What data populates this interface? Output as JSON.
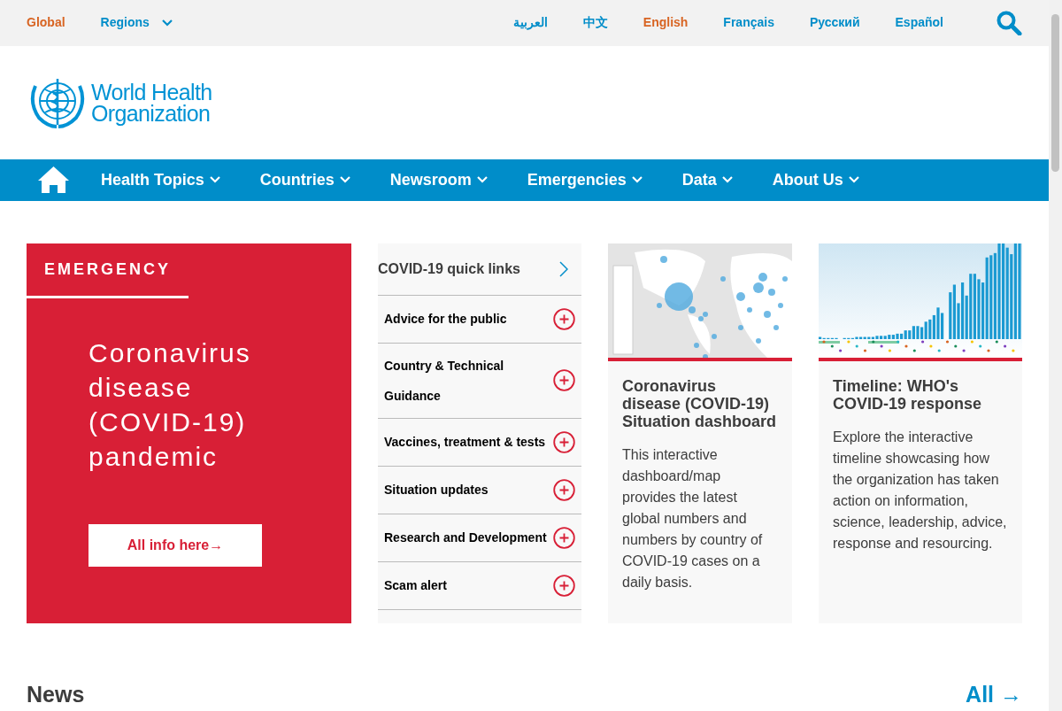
{
  "top_bar": {
    "scopes": [
      {
        "label": "Global",
        "selected": true
      },
      {
        "label": "Regions",
        "selected": false,
        "dropdown": true
      }
    ],
    "languages": [
      {
        "label": "العربية",
        "selected": false
      },
      {
        "label": "中文",
        "selected": false
      },
      {
        "label": "English",
        "selected": true
      },
      {
        "label": "Français",
        "selected": false
      },
      {
        "label": "Русский",
        "selected": false
      },
      {
        "label": "Español",
        "selected": false
      }
    ]
  },
  "logo": {
    "line_1": "World Health",
    "line_2": "Organization"
  },
  "nav": {
    "items": [
      "Health Topics",
      "Countries",
      "Newsroom",
      "Emergencies",
      "Data",
      "About Us"
    ]
  },
  "emergency": {
    "label": "EMERGENCY",
    "title": "Coronavirus disease (COVID-19) pandemic",
    "button": "All info here→"
  },
  "quick_links": {
    "title": "COVID-19 quick links",
    "items": [
      "Advice for the public",
      "Country & Technical Guidance",
      "Vaccines, treatment & tests",
      "Situation updates",
      "Research and Development",
      "Scam alert"
    ]
  },
  "cards": [
    {
      "kind": "map",
      "title": "Coronavirus disease (COVID-19) Situation dashboard",
      "text": "This interactive dashboard/map provides the latest global numbers and numbers by country of COVID-19 cases on a daily basis."
    },
    {
      "kind": "timeline",
      "title": "Timeline: WHO's COVID-19 response",
      "text": "Explore the interactive timeline showcasing how the organization has taken action on information, science, leadership, advice, response and resourcing."
    }
  ],
  "news": {
    "title": "News",
    "link": "All →"
  }
}
